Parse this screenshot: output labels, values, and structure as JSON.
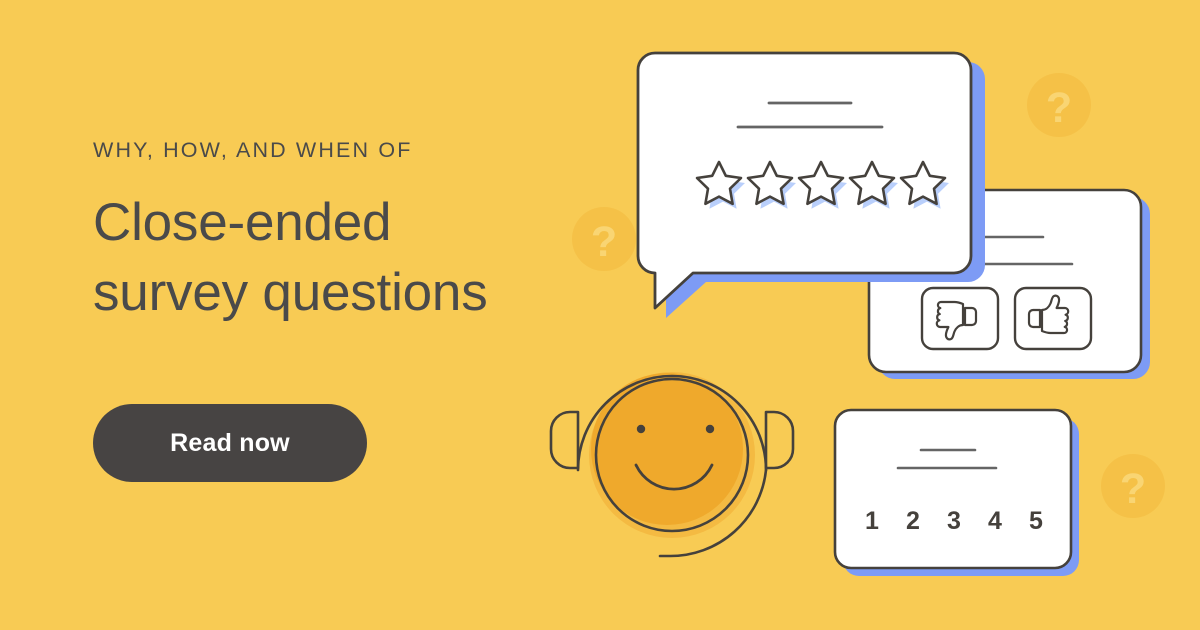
{
  "meta": {
    "background_color": "#F8CB54",
    "ink_color": "#45413C",
    "accent_blue": "#7D9BF5",
    "text_color": "#4A4A4A",
    "button_color": "#474443",
    "smiley_fill": "#EFA92C",
    "smiley_halo": "#F4BA42",
    "deco_circle_color": "#F6C246",
    "deco_glyph_color": "#F9D371"
  },
  "hero": {
    "eyebrow": "WHY, HOW, AND WHEN OF",
    "headline_line_1": "Close-ended",
    "headline_line_2": "survey questions",
    "cta_label": "Read now"
  },
  "illustration": {
    "speech_bubble": {
      "name": "star-rating-speech-bubble",
      "stars_count": 5,
      "star_fill": "#BBD0FC",
      "lines": 2
    },
    "thumbs_card": {
      "name": "thumbs-feedback-card",
      "lines": 2,
      "options": [
        {
          "icon": "thumbs-down-icon",
          "label": "Thumbs down"
        },
        {
          "icon": "thumbs-up-icon",
          "label": "Thumbs up"
        }
      ]
    },
    "scale_card": {
      "name": "numeric-scale-card",
      "lines": 2,
      "scale": [
        "1",
        "2",
        "3",
        "4",
        "5"
      ]
    },
    "agent": {
      "name": "smiley-headset-agent",
      "expression": "smiling",
      "accessory": "headset"
    },
    "decorations": [
      {
        "name": "question-mark-deco-1",
        "glyph": "?"
      },
      {
        "name": "question-mark-deco-2",
        "glyph": "?"
      },
      {
        "name": "question-mark-deco-3",
        "glyph": "?"
      }
    ]
  }
}
